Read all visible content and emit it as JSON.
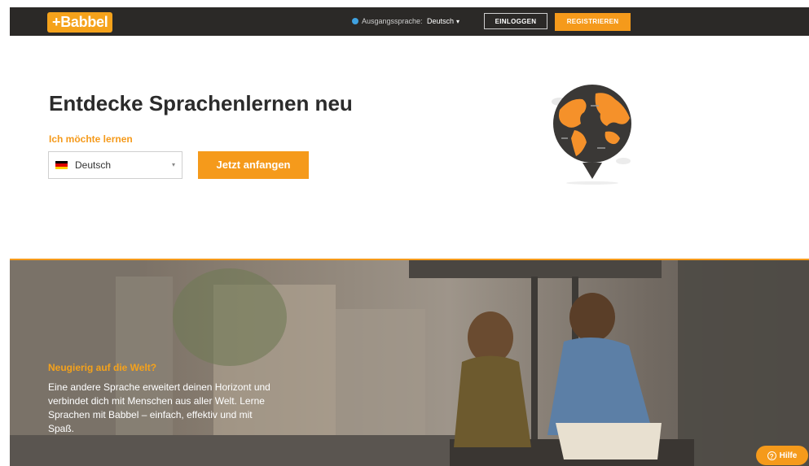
{
  "header": {
    "logo": "+Babbel",
    "source_language_label": "Ausgangssprache:",
    "source_language_value": "Deutsch",
    "login_label": "EINLOGGEN",
    "register_label": "REGISTRIEREN"
  },
  "hero": {
    "headline": "Entdecke Sprachenlernen neu",
    "learn_label": "Ich möchte lernen",
    "language_select_value": "Deutsch",
    "start_button": "Jetzt anfangen"
  },
  "teaser": {
    "title": "Neugierig auf die Welt?",
    "text": "Eine andere Sprache erweitert deinen Horizont und verbindet dich mit Menschen aus aller Welt. Lerne Sprachen mit Babbel – einfach, effektiv und mit Spaß."
  },
  "help_button": "Hilfe",
  "colors": {
    "accent": "#f59a1b",
    "header_bg": "#2b2927",
    "headline": "#2b2b2b",
    "globe_dark": "#3a3836"
  },
  "icons": {
    "source_language": "globe-icon",
    "select_caret": "chevron-down-icon",
    "flag": "german-flag-icon",
    "help": "question-circle-icon",
    "illustration": "globe-map-pin-illustration"
  }
}
